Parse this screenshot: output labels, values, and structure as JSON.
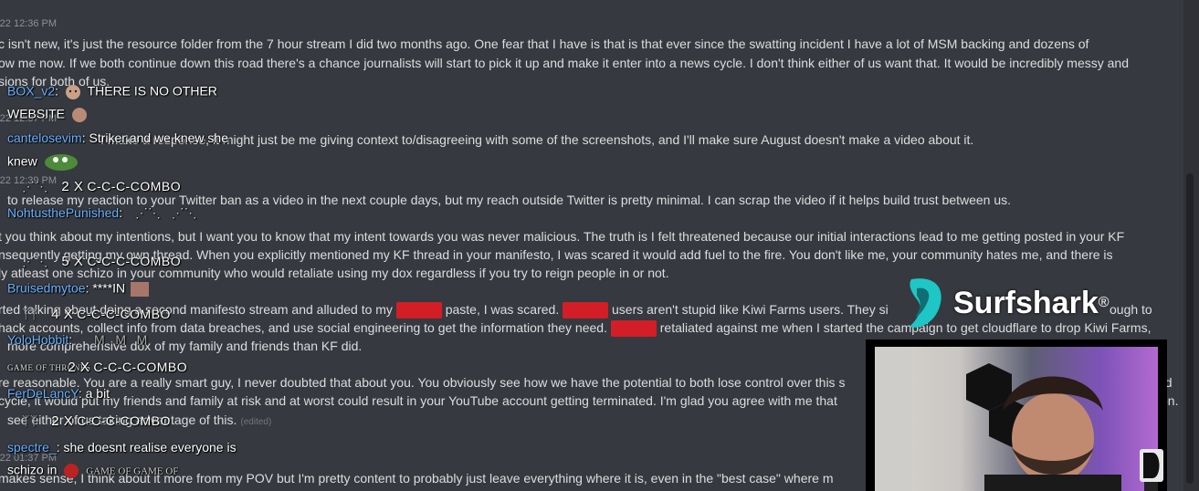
{
  "messages": {
    "ts1": "-22 12:36 PM",
    "line1": "c isn't new, it's just the resource folder from the 7 hour stream I did two months ago. One fear that I have is that is that ever since the swatting incident I have a lot of MSM backing and dozens of",
    "line2": "ow me now. If we both continue down this road there's a chance journalists will start to pick it up and make it enter into a news cycle. I don't think either of us want that. It would be incredibly messy and",
    "line3": "sions for both of us.",
    "ts2": "-22 12:37 PM",
    "line4": "I make a response, it might just be me giving context to/disagreeing with some of the screenshots, and I'll make sure August doesn't make a video about it.",
    "ts3": "-22 12:39 PM",
    "line5": "to release my reaction to your Twitter ban as a video in the next couple days, but my reach outside Twitter is pretty minimal. I can scrap the video if it helps build trust between us.",
    "line6": "t you think about my intentions, but I want you to know that my intent towards you was never malicious. The truth is I felt threatened because our initial interactions lead to me getting posted in your KF",
    "line7": "nsequently getting my own thread. When you explicitly mentioned my KF thread in your manifesto, I was scared it would add fuel to the fire. You don't like me, your community hates me, and there is",
    "line8": "ly atleast one schizo in your community who would retaliate using my dox regardless if you try to reign people in or not.",
    "line9a": "rted talking about doing a second manifesto stream and alluded to my",
    "line9b": "paste, I was scared.",
    "line9c": "users aren't stupid like Kiwi Farms users. They si",
    "line9d": "ough to",
    "line10a": "hack accounts, collect info from data breaches, and use social engineering to get the information they need.",
    "line10b": "retaliated against me when I started the campaign to get cloudflare to drop Kiwi Farms,",
    "line11": "more comprehensive dox of my family and friends than KF did.",
    "line12": "re reasonable. You are a really smart guy, I never doubted that about you. You obviously see how we have the potential to both lose control over this s",
    "line12b": "ed",
    "line13": "cycle, it would put my friends and family at risk and at worst could result in your YouTube account getting terminated. I'm glad you agree with me that",
    "line13b": "on.",
    "line14": "see either of us taking advantage of this.",
    "edited": "(edited)",
    "ts4": "-22 01:37 PM",
    "line15": "makes sense, I think about it more from my POV but I'm pretty content to probably just leave everything where it is, even in the \"best case\" where m"
  },
  "chat": {
    "c1_user": "BOX_v2",
    "c1_text": "THERE IS NO OTHER",
    "c1_text2": "WEBSITE",
    "c2_user": "cantelosevim",
    "c2_text": "Striker and we knew she",
    "c2_text2": "knew",
    "combo1_mult": "2 X",
    "combo1_text": "C-C-C-COMBO",
    "c3_user": "NohtusthePunished",
    "combo2_mult": "5 X",
    "combo2_text": "C-C-C-COMBO",
    "c4_user": "Bruisedmytoe",
    "c4_text": "****IN",
    "combo3_mult": "4 X",
    "combo3_text": "C-C-C-COMBO",
    "c5_user": "YoloHobbit",
    "combo4_mult": "2 X",
    "combo4_text": "C-C-C-COMBO",
    "c6_user": "FerDeLancY",
    "c6_text": "a bit",
    "combo5_mult": "2 X",
    "combo5_text": "C-C-C-COMBO",
    "c7_user": "spectre_",
    "c7_text": "she doesnt realise everyone is",
    "c7_text2": "schizo in",
    "emote_label_got": "GAME OF THRONES",
    "emote_label_got2": "GAME OF GAME OF"
  },
  "sponsor": {
    "brand": "Surfshark",
    "reg": "®"
  },
  "colors": {
    "background": "#36393f",
    "chat_user": "#6ab0ff",
    "redaction": "#d21e26"
  }
}
